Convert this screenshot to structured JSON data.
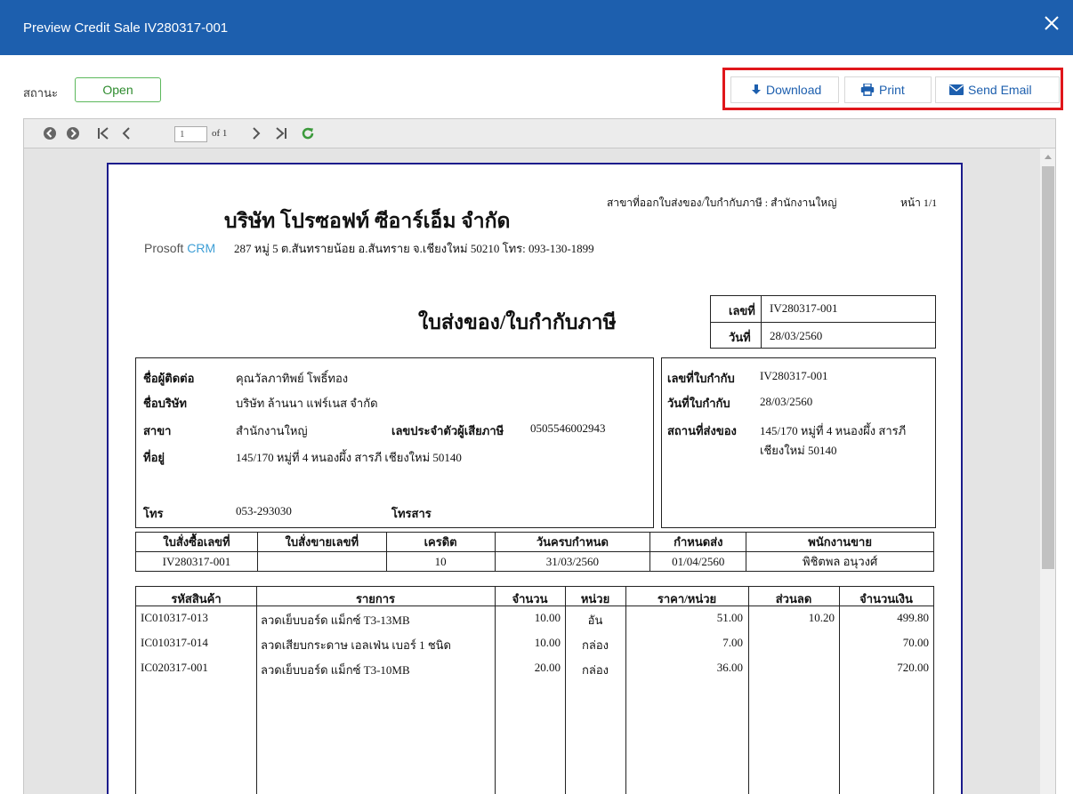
{
  "window": {
    "title": "Preview Credit Sale IV280317-001"
  },
  "status": {
    "label": "สถานะ",
    "value": "Open"
  },
  "actions": {
    "download": "Download",
    "print": "Print",
    "send_email": "Send Email"
  },
  "viewer": {
    "page_current": "1",
    "page_of": "of 1"
  },
  "document": {
    "branch_line": "สาขาที่ออกใบส่งของ/ใบกำกับภาษี : สำนักงานใหญ่",
    "page_label": "หน้า 1/1",
    "company_name": "บริษัท โปรซอฟท์ ซีอาร์เอ็ม จำกัด",
    "logo_text_main": "Prosoft",
    "logo_text_crm": "CRM",
    "company_address": "287 หมู่ 5 ต.สันทรายน้อย อ.สันทราย จ.เชียงใหม่ 50210 โทร: 093-130-1899",
    "doc_title": "ใบส่งของ/ใบกำกับภาษี",
    "doc_no_label": "เลขที่",
    "doc_no": "IV280317-001",
    "doc_date_label": "วันที่",
    "doc_date": "28/03/2560",
    "customer": {
      "contact_label": "ชื่อผู้ติดต่อ",
      "contact": "คุณวัลภาทิพย์ โพธิ์ทอง",
      "company_label": "ชื่อบริษัท",
      "company": "บริษัท ล้านนา แฟร์เนส จำกัด",
      "branch_label": "สาขา",
      "branch": "สำนักงานใหญ่",
      "taxid_label": "เลขประจำตัวผู้เสียภาษี",
      "taxid": "0505546002943",
      "address_label": "ที่อยู่",
      "address": "145/170 หมู่ที่ 4 หนองผึ้ง สารภี เชียงใหม่ 50140",
      "phone_label": "โทร",
      "phone": "053-293030",
      "fax_label": "โทรสาร",
      "fax": ""
    },
    "invoice": {
      "no_label": "เลขที่ใบกำกับ",
      "no": "IV280317-001",
      "date_label": "วันที่ใบกำกับ",
      "date": "28/03/2560",
      "ship_label": "สถานที่ส่งของ",
      "ship_line1": "145/170 หมู่ที่ 4 หนองผึ้ง สารภี",
      "ship_line2": "เชียงใหม่ 50140"
    },
    "order_headers": [
      "ใบสั่งซื้อเลขที่",
      "ใบสั่งขายเลขที่",
      "เครดิต",
      "วันครบกำหนด",
      "กำหนดส่ง",
      "พนักงานขาย"
    ],
    "order_row": [
      "IV280317-001",
      "",
      "10",
      "31/03/2560",
      "01/04/2560",
      "พิชิตพล อนุวงศ์"
    ],
    "item_headers": [
      "รหัสสินค้า",
      "รายการ",
      "จำนวน",
      "หน่วย",
      "ราคา/หน่วย",
      "ส่วนลด",
      "จำนวนเงิน"
    ],
    "items": [
      {
        "code": "IC010317-013",
        "desc": "ลวดเย็บบอร์ด แม็กซ์ T3-13MB",
        "qty": "10.00",
        "unit": "อัน",
        "price": "51.00",
        "discount": "10.20",
        "amount": "499.80"
      },
      {
        "code": "IC010317-014",
        "desc": "ลวดเสียบกระดาษ เอลเฟ่น เบอร์ 1 ชนิด",
        "qty": "10.00",
        "unit": "กล่อง",
        "price": "7.00",
        "discount": "",
        "amount": "70.00"
      },
      {
        "code": "IC020317-001",
        "desc": "ลวดเย็บบอร์ด แม็กซ์ T3-10MB",
        "qty": "20.00",
        "unit": "กล่อง",
        "price": "36.00",
        "discount": "",
        "amount": "720.00"
      }
    ]
  },
  "colors": {
    "titlebar": "#1d5fae",
    "status_green": "#5cb85c",
    "highlight_red": "#e0161b",
    "paper_border": "#1c1c8c"
  }
}
